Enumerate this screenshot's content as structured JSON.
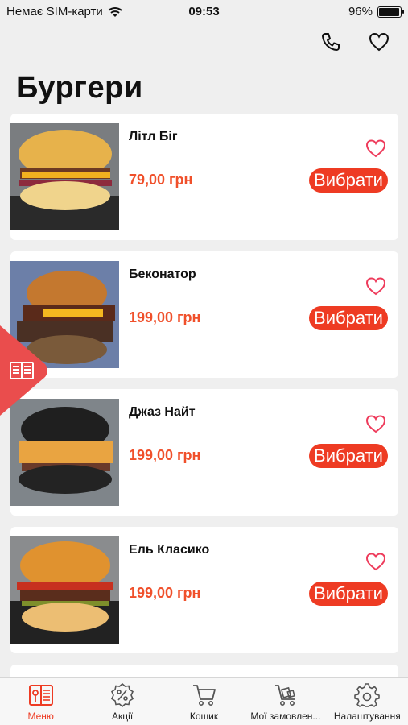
{
  "status_bar": {
    "carrier": "Немає SIM-карти",
    "time": "09:53",
    "battery": "96%",
    "battery_level": 0.96
  },
  "header": {
    "title": "Бургери"
  },
  "top_actions": {
    "phone_icon": "phone-icon",
    "favorites_icon": "heart-icon"
  },
  "products": [
    {
      "name": "Літл Біг",
      "price": "79,00 грн",
      "button": "Вибрати"
    },
    {
      "name": "Беконатор",
      "price": "199,00 грн",
      "button": "Вибрати"
    },
    {
      "name": "Джаз Найт",
      "price": "199,00 грн",
      "button": "Вибрати"
    },
    {
      "name": "Ель Класико",
      "price": "199,00 грн",
      "button": "Вибрати"
    }
  ],
  "side_tab": {
    "icon": "book-icon"
  },
  "tab_bar": {
    "active": "menu",
    "items": [
      {
        "id": "menu",
        "label": "Меню",
        "icon": "menu-book-icon"
      },
      {
        "id": "promos",
        "label": "Акції",
        "icon": "percent-badge-icon"
      },
      {
        "id": "cart",
        "label": "Кошик",
        "icon": "cart-icon"
      },
      {
        "id": "orders",
        "label": "Мої замовлен...",
        "icon": "trolley-icon"
      },
      {
        "id": "settings",
        "label": "Налаштування",
        "icon": "gear-icon"
      }
    ]
  },
  "colors": {
    "accent": "#ee3b23",
    "price": "#f0502b",
    "favorite": "#ee3b5b",
    "background": "#efefef"
  }
}
